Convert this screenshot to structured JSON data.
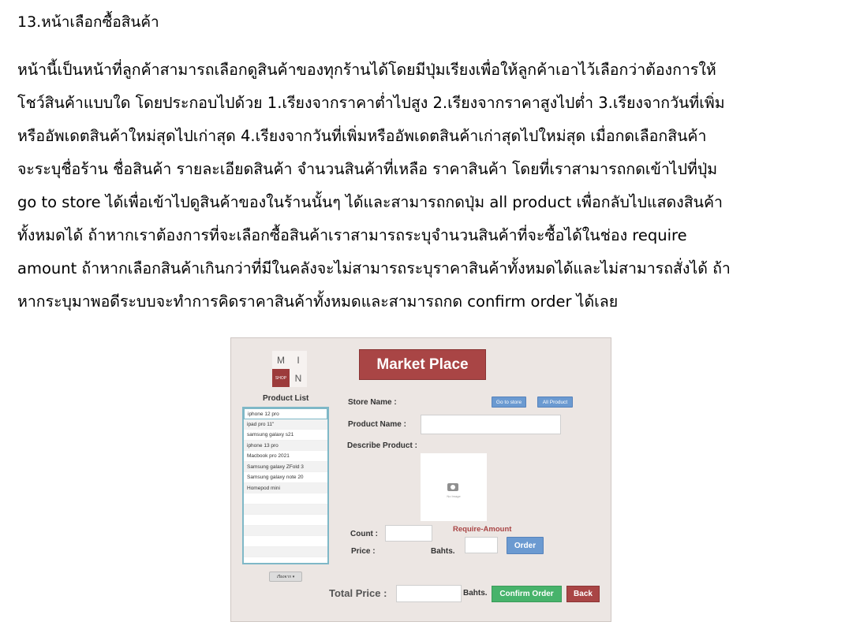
{
  "document": {
    "heading": "13.หน้าเลือกซื้อสินค้า",
    "lines": [
      {
        "text": "หน้านี้เป็นหน้าที่ลูกค้าสามารถเลือกดูสินค้าของทุกร้านได้โดยมีปุ่มเรียงเพื่อให้ลูกค้าเอาไว้เลือกว่าต้องการให้"
      },
      {
        "text": "โชว์สินค้าแบบใด โดยประกอบไปด้วย 1.เรียงจากราคาต่ำไปสูง 2.เรียงจากราคาสูงไปต่ำ 3.เรียงจากวันที่เพิ่ม"
      },
      {
        "text": "หรืออัพเดตสินค้าใหม่สุดไปเก่าสุด 4.เรียงจากวันที่เพิ่มหรืออัพเดตสินค้าเก่าสุดไปใหม่สุด เมื่อกดเลือกสินค้า"
      },
      {
        "text": "จะระบุชื่อร้าน ชื่อสินค้า รายละเอียดสินค้า จำนวนสินค้าที่เหลือ ราคาสินค้า โดยที่เราสามารถกดเข้าไปที่ปุ่ม"
      },
      {
        "text": "go to store ได้เพื่อเข้าไปดูสินค้าของในร้านนั้นๆ ได้และสามารถกดปุ่ม all product เพื่อกลับไปแสดงสินค้า"
      },
      {
        "text": "ทั้งหมดได้ ถ้าหากเราต้องการที่จะเลือกซื้อสินค้าเราสามารถระบุจำนวนสินค้าที่จะซื้อได้ในช่อง require"
      },
      {
        "text": "amount ถ้าหากเลือกสินค้าเกินกว่าที่มีในคลังจะไม่สามารถระบุราคาสินค้าทั้งหมดได้และไม่สามารถสั่งได้ ถ้า"
      },
      {
        "text": "หากระบุมาพอดีระบบจะทำการคิดราคาสินค้าทั้งหมดและสามารถกด confirm order ได้เลย"
      }
    ]
  },
  "screenshot": {
    "logo": {
      "m": "M",
      "i": "I",
      "shop": "SHOP",
      "n": "N"
    },
    "banner": "Market Place",
    "product_list_title": "Product List",
    "products": [
      "iphone 12 pro",
      "ipad pro 11\"",
      "samsung galaxy s21",
      "iphone 13 pro",
      "Macbook pro 2021",
      "Samsung galaxy ZFold 3",
      "Samsung galaxy note 20",
      "Homepod mini",
      "",
      "",
      "",
      "",
      "",
      ""
    ],
    "sort_label": "เรียงจาก ▾",
    "store_name_label": "Store Name :",
    "go_to_store": "Go to store",
    "all_product": "All Product",
    "product_name_label": "Product Name :",
    "describe_label": "Describe Product :",
    "no_image": "No Image",
    "count_label": "Count :",
    "price_label": "Price :",
    "bahts": "Bahts.",
    "require_amount": "Require-Amount",
    "order": "Order",
    "total_price_label": "Total Price :",
    "confirm_order": "Confirm Order",
    "back": "Back"
  }
}
